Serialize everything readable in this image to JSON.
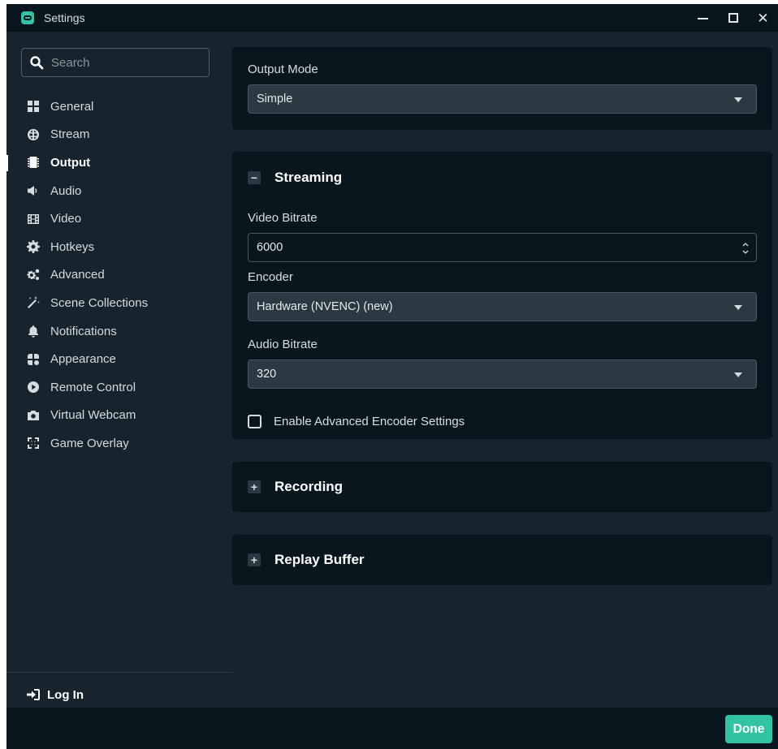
{
  "window": {
    "title": "Settings"
  },
  "search": {
    "placeholder": "Search"
  },
  "sidebar": {
    "items": [
      {
        "label": "General",
        "icon": "grid-icon"
      },
      {
        "label": "Stream",
        "icon": "globe-icon"
      },
      {
        "label": "Output",
        "icon": "chip-icon",
        "active": true
      },
      {
        "label": "Audio",
        "icon": "speaker-icon"
      },
      {
        "label": "Video",
        "icon": "film-icon"
      },
      {
        "label": "Hotkeys",
        "icon": "gear-icon"
      },
      {
        "label": "Advanced",
        "icon": "gears-icon"
      },
      {
        "label": "Scene Collections",
        "icon": "magic-wand-icon"
      },
      {
        "label": "Notifications",
        "icon": "bell-icon"
      },
      {
        "label": "Appearance",
        "icon": "palette-icon"
      },
      {
        "label": "Remote Control",
        "icon": "play-circle-icon"
      },
      {
        "label": "Virtual Webcam",
        "icon": "camera-icon"
      },
      {
        "label": "Game Overlay",
        "icon": "expand-icon"
      }
    ],
    "login_label": "Log In"
  },
  "output_mode": {
    "label": "Output Mode",
    "value": "Simple"
  },
  "streaming": {
    "title": "Streaming",
    "toggle": "−",
    "video_bitrate_label": "Video Bitrate",
    "video_bitrate_value": "6000",
    "encoder_label": "Encoder",
    "encoder_value": "Hardware (NVENC) (new)",
    "audio_bitrate_label": "Audio Bitrate",
    "audio_bitrate_value": "320",
    "advanced_checkbox_label": "Enable Advanced Encoder Settings"
  },
  "recording": {
    "title": "Recording",
    "toggle": "+"
  },
  "replay_buffer": {
    "title": "Replay Buffer",
    "toggle": "+"
  },
  "footer": {
    "done_label": "Done"
  },
  "colors": {
    "accent": "#31c3a2",
    "background": "#17242d",
    "panel": "#09161d",
    "input": "#2b3a42"
  }
}
